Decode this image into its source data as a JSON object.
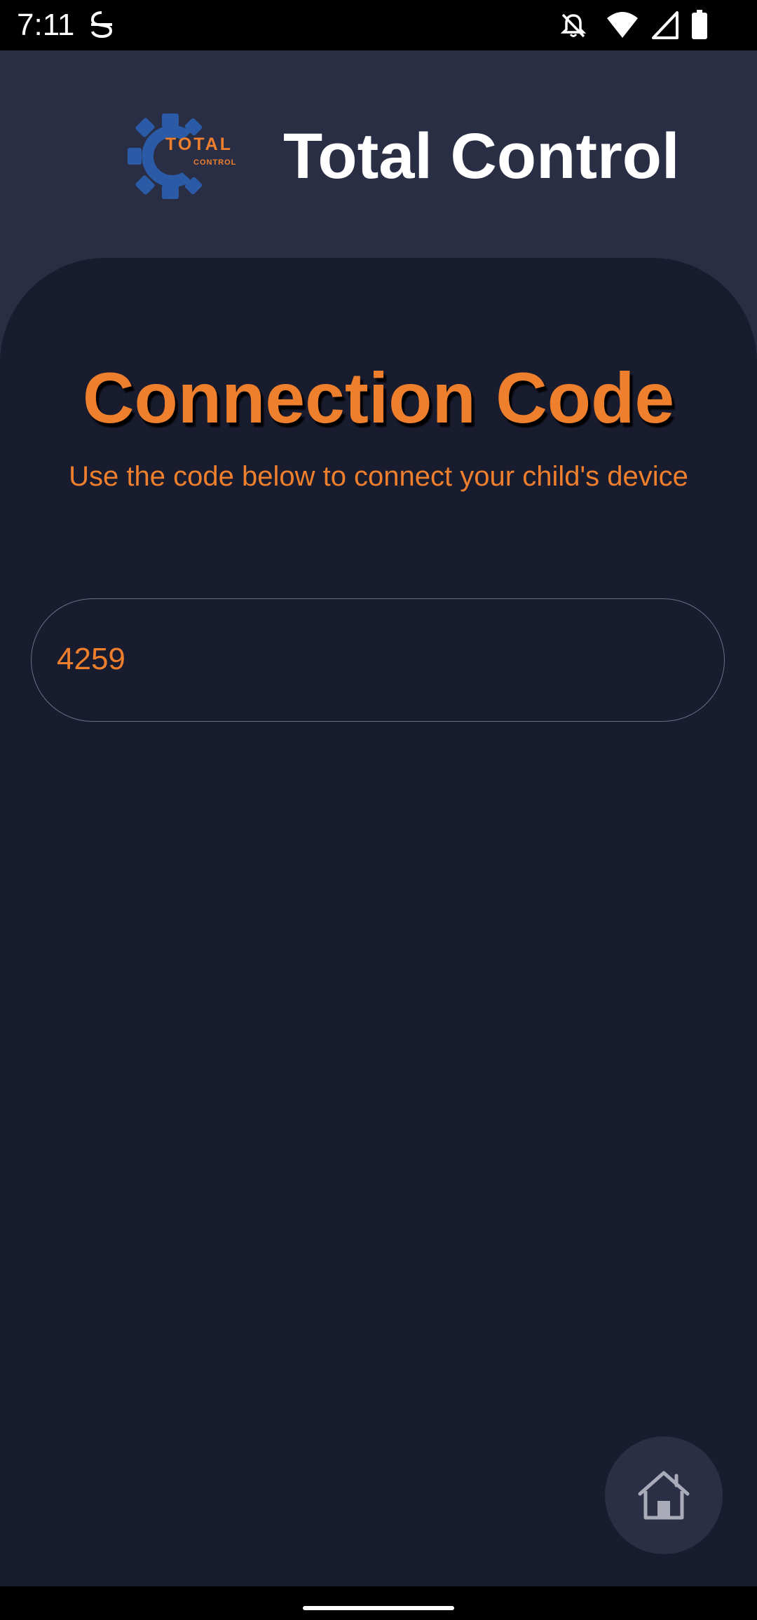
{
  "status_bar": {
    "time": "7:11",
    "icons": [
      "app-notification-icon",
      "bell-muted-icon",
      "wifi-icon",
      "cell-signal-icon",
      "battery-icon"
    ]
  },
  "header": {
    "logo_text_main": "TOTAL",
    "logo_text_sub": "CONTROL",
    "app_title": "Total Control"
  },
  "main": {
    "title": "Connection Code",
    "subtitle": "Use the code below to connect your child's device",
    "code_value": "4259"
  },
  "fab": {
    "icon": "home-icon"
  },
  "colors": {
    "accent": "#ee7f2d",
    "header_bg": "#2a2e45",
    "card_bg": "#191c2f",
    "logo_blue": "#2b5aa7"
  }
}
